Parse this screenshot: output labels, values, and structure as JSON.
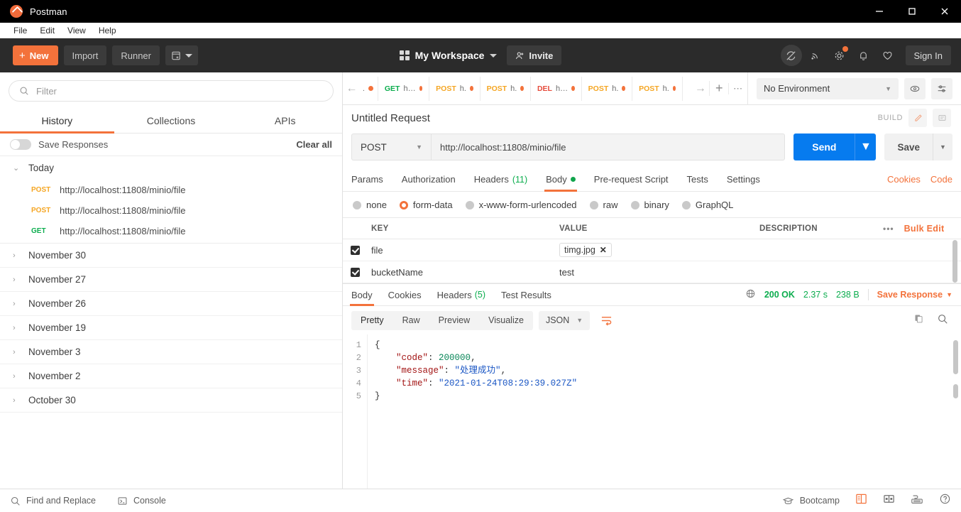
{
  "window": {
    "app_title": "Postman",
    "minimize": "minimize-icon",
    "maximize": "maximize-icon",
    "close": "close-icon"
  },
  "menubar": {
    "items": [
      "File",
      "Edit",
      "View",
      "Help"
    ]
  },
  "toolbar": {
    "new_label": "New",
    "new_plus": "+",
    "import_label": "Import",
    "runner_label": "Runner",
    "workspace_label": "My Workspace",
    "invite_label": "Invite",
    "signin_label": "Sign In",
    "icons": [
      "sync-off-icon",
      "broadcast-icon",
      "settings-gear-icon",
      "bell-icon",
      "heart-icon"
    ]
  },
  "sidebar": {
    "filter_placeholder": "Filter",
    "tabs": [
      {
        "label": "History",
        "selected": true
      },
      {
        "label": "Collections",
        "selected": false
      },
      {
        "label": "APIs",
        "selected": false
      }
    ],
    "save_responses_label": "Save Responses",
    "clear_all_label": "Clear all",
    "groups": [
      {
        "label": "Today",
        "expanded": true,
        "items": [
          {
            "method": "POST",
            "url": "http://localhost:11808/minio/file"
          },
          {
            "method": "POST",
            "url": "http://localhost:11808/minio/file"
          },
          {
            "method": "GET",
            "url": "http://localhost:11808/minio/file"
          }
        ]
      },
      {
        "label": "November 30",
        "expanded": false,
        "items": []
      },
      {
        "label": "November 27",
        "expanded": false,
        "items": []
      },
      {
        "label": "November 26",
        "expanded": false,
        "items": []
      },
      {
        "label": "November 19",
        "expanded": false,
        "items": []
      },
      {
        "label": "November 3",
        "expanded": false,
        "items": []
      },
      {
        "label": "November 2",
        "expanded": false,
        "items": []
      },
      {
        "label": "October 30",
        "expanded": false,
        "items": []
      }
    ]
  },
  "request_tabs": {
    "tabs": [
      {
        "method": "",
        "title": ".",
        "unsaved": true
      },
      {
        "method": "GET",
        "title": "h…",
        "unsaved": true
      },
      {
        "method": "POST",
        "title": "h.",
        "unsaved": true
      },
      {
        "method": "POST",
        "title": "h.",
        "unsaved": true
      },
      {
        "method": "DEL",
        "title": "h…",
        "unsaved": true
      },
      {
        "method": "POST",
        "title": "h.",
        "unsaved": true
      },
      {
        "method": "POST",
        "title": "h.",
        "unsaved": true
      }
    ],
    "add_label": "+",
    "more_label": "⋯",
    "environment_label": "No Environment",
    "eye_icon": "eye-icon",
    "settings_icon": "sliders-icon"
  },
  "request": {
    "name": "Untitled Request",
    "build_label": "BUILD",
    "method": "POST",
    "url": "http://localhost:11808/minio/file",
    "send_label": "Send",
    "save_label": "Save",
    "tabs": [
      {
        "label": "Params",
        "selected": false
      },
      {
        "label": "Authorization",
        "selected": false
      },
      {
        "label": "Headers",
        "count": "(11)",
        "selected": false
      },
      {
        "label": "Body",
        "dot": true,
        "selected": true
      },
      {
        "label": "Pre-request Script",
        "selected": false
      },
      {
        "label": "Tests",
        "selected": false
      },
      {
        "label": "Settings",
        "selected": false
      }
    ],
    "cookies_label": "Cookies",
    "code_label": "Code",
    "body_types": [
      {
        "label": "none",
        "selected": false
      },
      {
        "label": "form-data",
        "selected": true
      },
      {
        "label": "x-www-form-urlencoded",
        "selected": false
      },
      {
        "label": "raw",
        "selected": false
      },
      {
        "label": "binary",
        "selected": false
      },
      {
        "label": "GraphQL",
        "selected": false
      }
    ],
    "table": {
      "headers": [
        "KEY",
        "VALUE",
        "DESCRIPTION"
      ],
      "more_label": "•••",
      "bulk_edit_label": "Bulk Edit",
      "rows": [
        {
          "checked": true,
          "key": "file",
          "value": "timg.jpg",
          "value_is_file": true,
          "description": ""
        },
        {
          "checked": true,
          "key": "bucketName",
          "value": "test",
          "value_is_file": false,
          "description": ""
        }
      ]
    }
  },
  "response": {
    "tabs": [
      {
        "label": "Body",
        "selected": true
      },
      {
        "label": "Cookies",
        "selected": false
      },
      {
        "label": "Headers",
        "count": "(5)",
        "selected": false
      },
      {
        "label": "Test Results",
        "selected": false
      }
    ],
    "globe_icon": "globe-icon",
    "status": "200 OK",
    "time": "2.37 s",
    "size": "238 B",
    "save_response_label": "Save Response",
    "view_modes": [
      {
        "label": "Pretty",
        "selected": true
      },
      {
        "label": "Raw",
        "selected": false
      },
      {
        "label": "Preview",
        "selected": false
      },
      {
        "label": "Visualize",
        "selected": false
      }
    ],
    "format": "JSON",
    "wrap_icon": "wrap-lines-icon",
    "copy_icon": "copy-icon",
    "search_icon": "search-icon",
    "body_lines": [
      {
        "n": "1",
        "segments": [
          {
            "t": "{",
            "c": "cp"
          }
        ]
      },
      {
        "n": "2",
        "indent": 4,
        "segments": [
          {
            "t": "\"code\"",
            "c": "ck"
          },
          {
            "t": ": ",
            "c": "cp"
          },
          {
            "t": "200000",
            "c": "cn"
          },
          {
            "t": ",",
            "c": "cp"
          }
        ]
      },
      {
        "n": "3",
        "indent": 4,
        "segments": [
          {
            "t": "\"message\"",
            "c": "ck"
          },
          {
            "t": ": ",
            "c": "cp"
          },
          {
            "t": "\"处理成功\"",
            "c": "cs"
          },
          {
            "t": ",",
            "c": "cp"
          }
        ]
      },
      {
        "n": "4",
        "indent": 4,
        "segments": [
          {
            "t": "\"time\"",
            "c": "ck"
          },
          {
            "t": ": ",
            "c": "cp"
          },
          {
            "t": "\"2021-01-24T08:29:39.027Z\"",
            "c": "cs"
          }
        ]
      },
      {
        "n": "5",
        "segments": [
          {
            "t": "}",
            "c": "cp"
          }
        ]
      }
    ]
  },
  "statusbar": {
    "find_replace_label": "Find and Replace",
    "console_label": "Console",
    "bootcamp_label": "Bootcamp",
    "right_icons": [
      "two-pane-layout-icon",
      "split-layout-icon",
      "keyboard-icon",
      "help-icon"
    ]
  },
  "colors": {
    "accent": "#f3723b",
    "send_blue": "#067bef",
    "success_green": "#0cad4e",
    "post_orange": "#f5a623",
    "delete_red": "#e64c3c",
    "dark_bg": "#2b2b2b",
    "titlebar_bg": "#000000"
  }
}
